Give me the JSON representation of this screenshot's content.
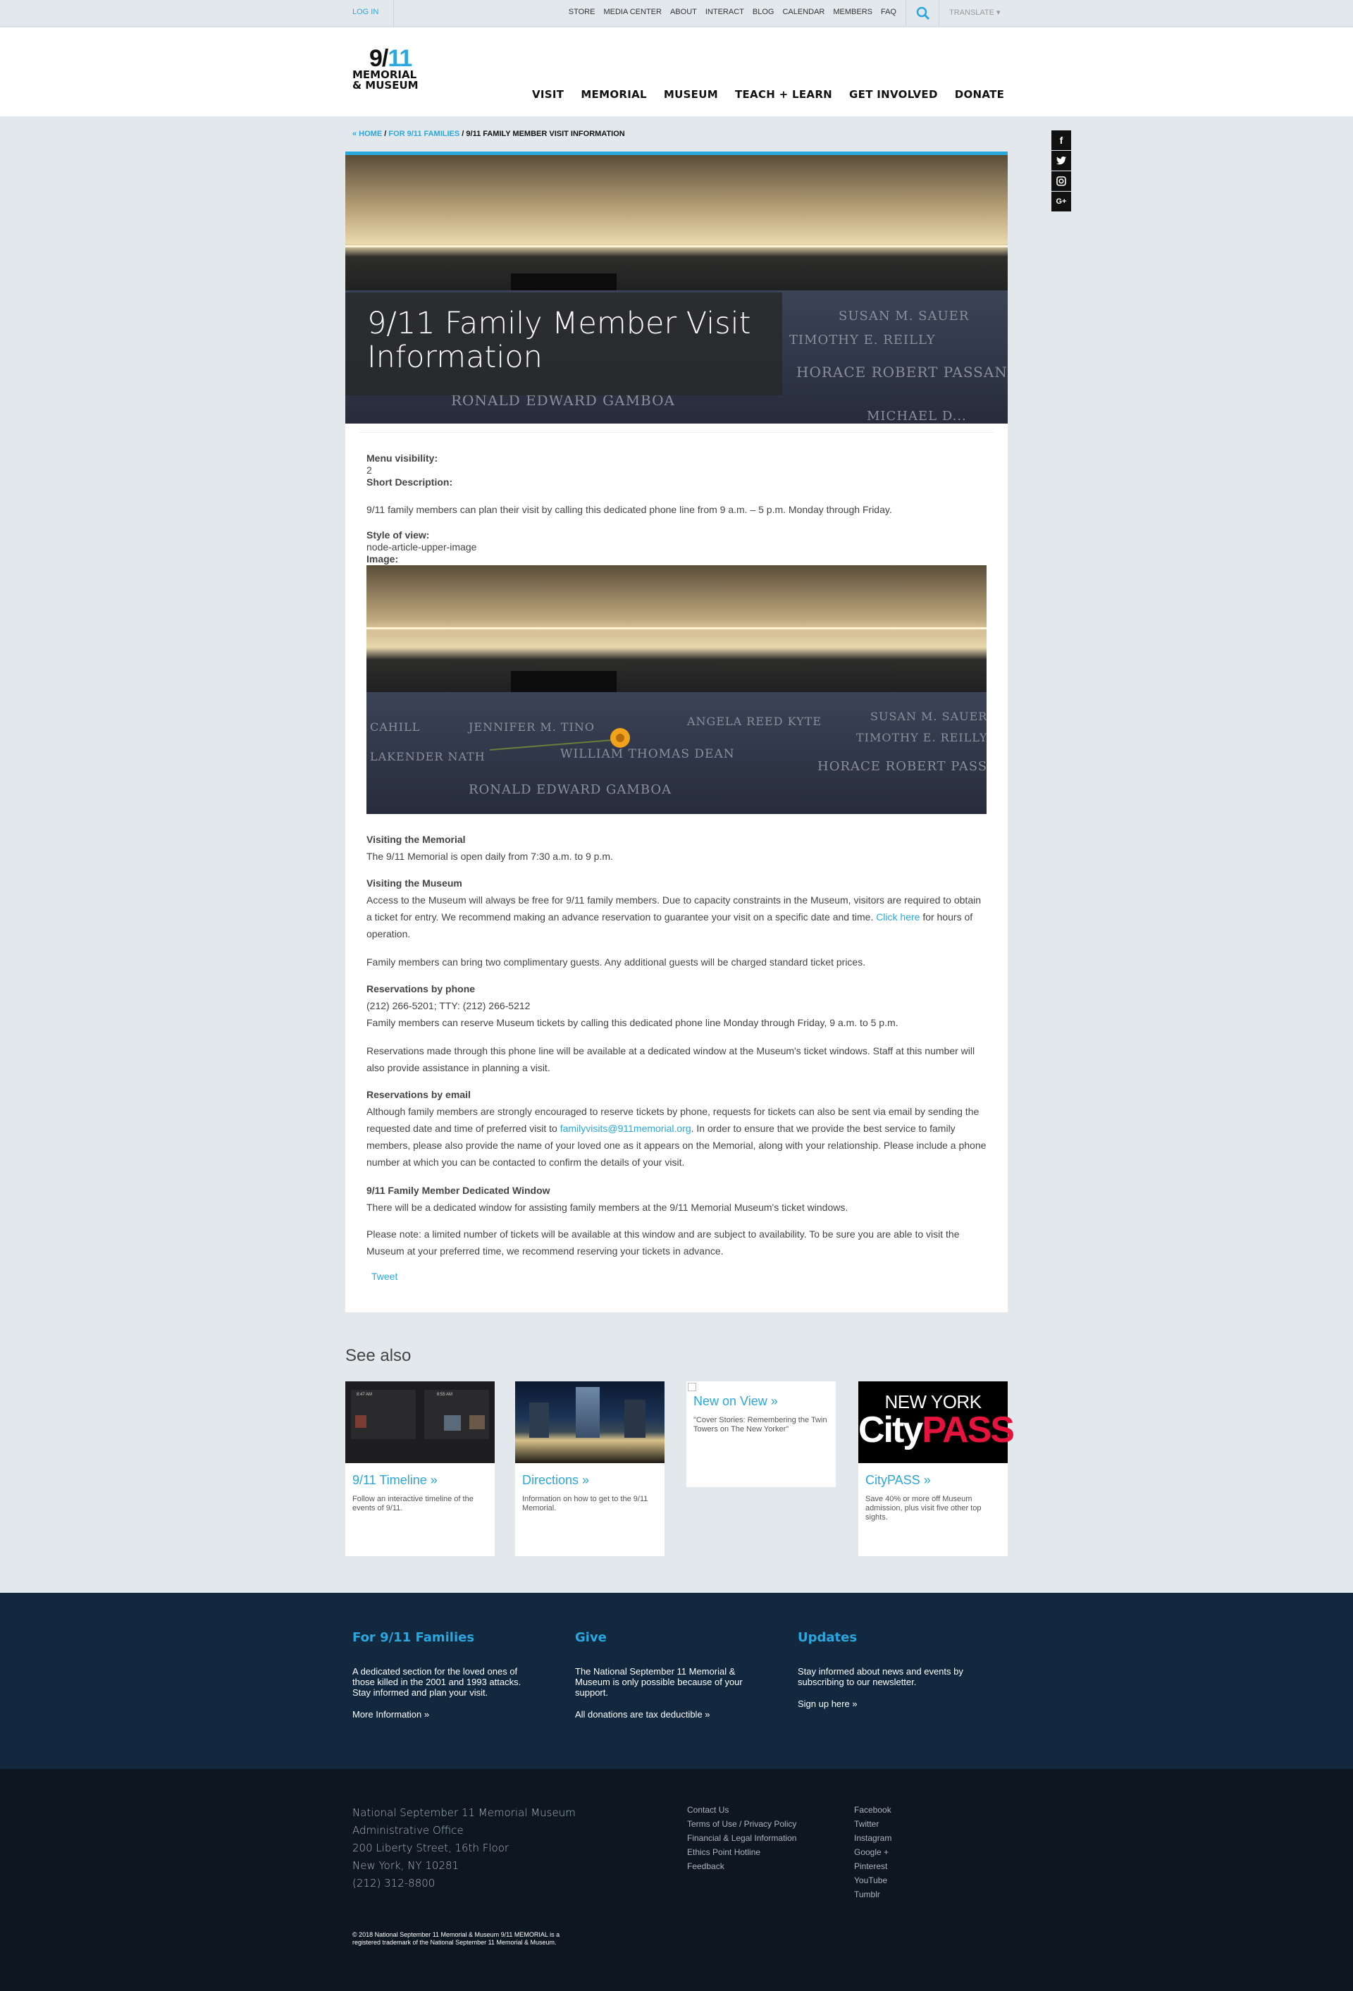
{
  "utility": {
    "login": "LOG IN",
    "links": [
      "STORE",
      "MEDIA CENTER",
      "ABOUT",
      "INTERACT",
      "BLOG",
      "CALENDAR",
      "MEMBERS",
      "FAQ"
    ],
    "translate": "TRANSLATE ▾"
  },
  "logo": {
    "line1a": "9/",
    "line1b": "11",
    "line2": "MEMORIAL",
    "line3": "& MUSEUM"
  },
  "nav": [
    "VISIT",
    "MEMORIAL",
    "MUSEUM",
    "TEACH + LEARN",
    "GET INVOLVED",
    "DONATE"
  ],
  "breadcrumb": {
    "home": "« HOME",
    "sep": " / ",
    "parent": "FOR 9/11 FAMILIES",
    "current": "9/11 FAMILY MEMBER VISIT INFORMATION"
  },
  "share": [
    "f",
    "t",
    "◎",
    "G+"
  ],
  "hero": {
    "title": "9/11 Family Member Visit Information",
    "names": [
      "SUSAN M. SAUER",
      "ANGELA REED KYTE",
      "TIMOTHY E. REILLY",
      "HORACE ROBERT PASSANANTI",
      "WILLIAM THOMAS DEAN",
      "RONALD EDWARD GAMBOA",
      "MICHAEL D..."
    ]
  },
  "content": {
    "menu_visibility_label": "Menu visibility:",
    "menu_visibility_value": "2",
    "short_desc_label": "Short Description:",
    "short_desc": "9/11 family members can plan their visit by calling this dedicated phone line from 9 a.m. – 5 p.m. Monday through Friday.",
    "style_label": "Style of view:",
    "style_value": "node-article-upper-image",
    "image_label": "Image:",
    "image_names": [
      "CAHILL",
      "JENNIFER M. TINO",
      "ANGELA REED KYTE",
      "SUSAN M. SAUER",
      "TIMOTHY E. REILLY",
      "LAKENDER NATH",
      "WILLIAM THOMAS DEAN",
      "HORACE ROBERT PASSANANTI",
      "RONALD EDWARD GAMBOA"
    ],
    "visiting_memorial_h": "Visiting the Memorial",
    "visiting_memorial": "The 9/11 Memorial is open daily from 7:30 a.m. to 9 p.m.",
    "visiting_museum_h": "Visiting the Museum",
    "visiting_museum_a": "Access to the Museum will always be free for 9/11 family members. Due to capacity constraints in the Museum, visitors are required to obtain a ticket for entry. We recommend making an advance reservation to guarantee your visit on a specific date and time.",
    "click_here": "Click here",
    "visiting_museum_b": " for hours of operation.",
    "guests": "Family members can bring two complimentary guests. Any additional guests will be charged standard ticket prices.",
    "res_phone_h": "Reservations by phone",
    "res_phone_numbers": "(212) 266-5201; TTY: (212) 266-5212",
    "res_phone_text": "Family members can reserve Museum tickets by calling this dedicated phone line Monday through Friday, 9 a.m. to 5 p.m.",
    "res_phone_text2": "Reservations made through this phone line will be available at a dedicated window at the Museum's ticket windows. Staff at this number will also provide assistance in planning a visit.",
    "res_email_h": "Reservations by email",
    "res_email_a": "Although family members are strongly encouraged to reserve tickets by phone, requests for tickets can also be sent via email by sending the requested date and time of preferred visit to ",
    "res_email_link": "familyvisits@911memorial.org",
    "res_email_b": ". In order to ensure that we provide the best service to family members, please also provide the name of your loved one as it appears on the Memorial, along with your relationship. Please include a phone number at which you can be contacted to confirm the details of your visit.",
    "window_h": "9/11 Family Member Dedicated Window",
    "window_text": "There will be a dedicated window for assisting family members at the 9/11 Memorial Museum's ticket windows.",
    "window_note": "Please note: a limited number of tickets will be available at this window and are subject to availability. To be sure you are able to visit the Museum at your preferred time, we recommend reserving your tickets in advance.",
    "tweet": "Tweet"
  },
  "see_also": {
    "title": "See also",
    "cards": [
      {
        "link": "9/11 Timeline »",
        "desc": "Follow an interactive timeline of the events of 9/11."
      },
      {
        "link": "Directions »",
        "desc": "Information on how to get to the 9/11 Memorial."
      },
      {
        "link": "New on View »",
        "desc": "\"Cover Stories: Remembering the Twin Towers on The New Yorker\""
      },
      {
        "link": "CityPASS »",
        "desc": "Save 40% or more off Museum admission, plus visit five other top sights."
      }
    ],
    "citypass_top": "NEW YORK",
    "citypass_city": "City",
    "citypass_pass": "PASS",
    "timeline_times": [
      "8:47 AM",
      "8:55 AM"
    ]
  },
  "families_footer": [
    {
      "title": "For 9/11 Families",
      "desc": "A dedicated section for the loved ones of those killed in the 2001 and 1993 attacks. Stay informed and plan your visit.",
      "link": "More Information »"
    },
    {
      "title": "Give",
      "desc": "The National September 11 Memorial & Museum is only possible because of your support.",
      "link": "All donations are tax deductible »"
    },
    {
      "title": "Updates",
      "desc": "Stay informed about news and events by subscribing to our newsletter.",
      "link": "Sign up here »"
    }
  ],
  "bottom_footer": {
    "address": [
      "National September 11 Memorial Museum",
      "Administrative Office",
      "200 Liberty Street, 16th Floor",
      "New York, NY 10281",
      "(212) 312-8800"
    ],
    "links1": [
      "Contact Us",
      "Terms of Use / Privacy Policy",
      "Financial & Legal Information",
      "Ethics Point Hotline",
      "Feedback"
    ],
    "links2": [
      "Facebook",
      "Twitter",
      "Instagram",
      "Google +",
      "Pinterest",
      "YouTube",
      "Tumblr"
    ],
    "copyright": "© 2018 National September 11 Memorial & Museum 9/11 MEMORIAL is a registered trademark of the National September 11 Memorial & Museum."
  },
  "colors": {
    "accent": "#29a7df",
    "navy": "#11283e",
    "footer": "#0c1722",
    "page_bg": "#e2e8ec"
  }
}
